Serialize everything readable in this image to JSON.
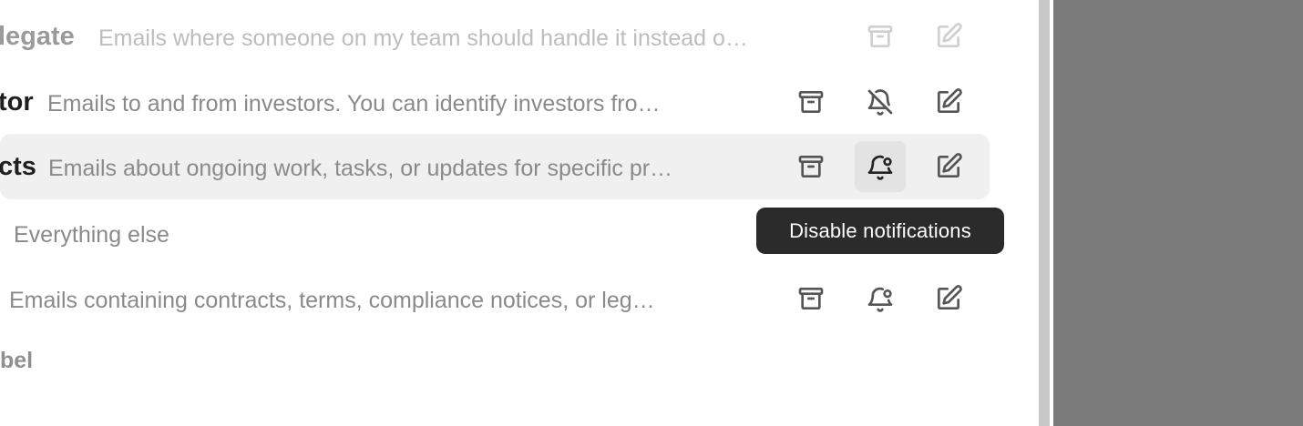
{
  "labels": [
    {
      "name": "legate",
      "description": "Emails where someone on my team should handle it instead o…",
      "notifications_icon": "pencil-icon"
    },
    {
      "name": "tor",
      "description": "Emails to and from investors. You can identify investors fro…",
      "notifications_icon": "bell-off-icon"
    },
    {
      "name": "cts",
      "description": "Emails about ongoing work, tasks, or updates for specific pr…",
      "notifications_icon": "bell-icon"
    },
    {
      "name": "",
      "description": "Everything else"
    },
    {
      "name": "",
      "description": "Emails containing contracts, terms, compliance notices, or leg…",
      "notifications_icon": "bell-icon"
    }
  ],
  "add_label": "bel",
  "tooltip": "Disable notifications",
  "icons": {
    "archive": "archive-icon",
    "bell": "bell-icon",
    "bell_off": "bell-off-icon",
    "edit": "edit-icon"
  },
  "colors": {
    "tooltip_bg": "#2b2b2b",
    "highlight_bg": "#f0f0f0",
    "overlay": "#7b7b7b"
  }
}
